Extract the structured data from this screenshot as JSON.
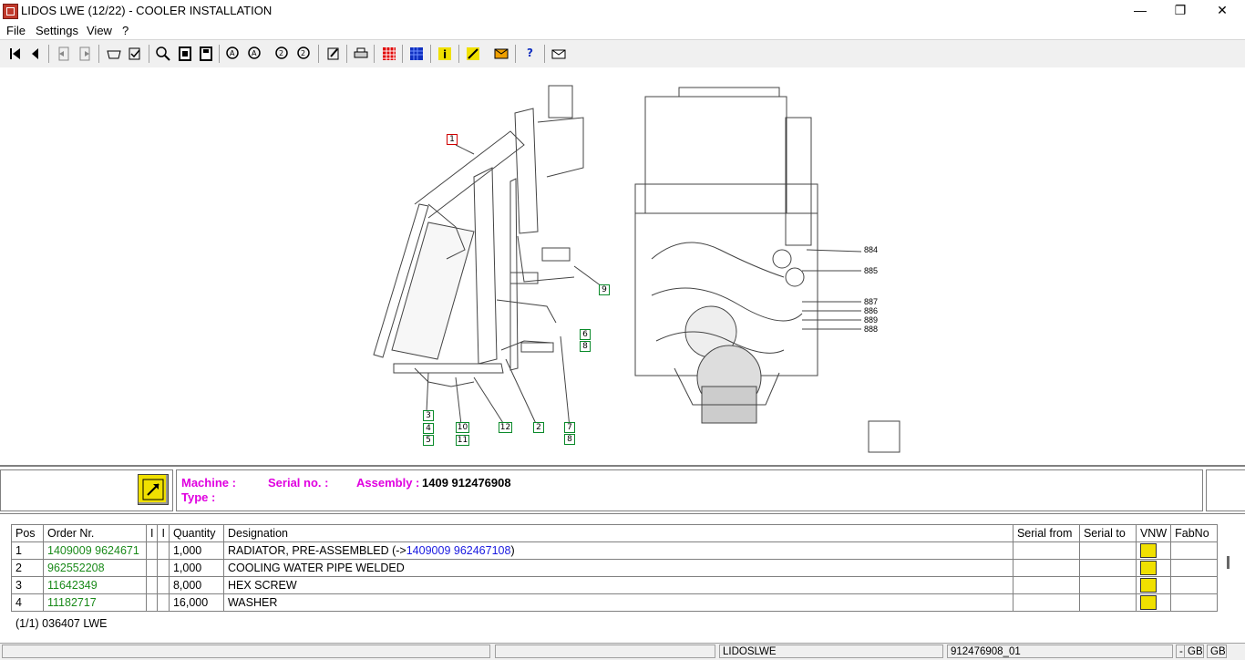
{
  "window": {
    "title": "LIDOS LWE (12/22) - COOLER INSTALLATION",
    "minimize": "—",
    "maximize": "❐",
    "close": "✕"
  },
  "menu": [
    "File",
    "Settings",
    "View",
    "?"
  ],
  "toolbar_icons": [
    "first-icon",
    "prev-icon",
    "back-icon",
    "forward-icon",
    "basket-icon",
    "checklist-icon",
    "zoom-icon",
    "page-icon",
    "page-fit-icon",
    "search-a-icon",
    "search-a2-icon",
    "search-2-icon",
    "search-22-icon",
    "edit-icon",
    "print-icon",
    "grid-icon",
    "filter-icon",
    "info-icon",
    "tools-icon",
    "order-icon",
    "help-icon",
    "mail-icon"
  ],
  "callouts": {
    "c1": "1",
    "c9": "9",
    "c6": "6",
    "c8a": "8",
    "c3": "3",
    "c4": "4",
    "c5": "5",
    "c10": "10",
    "c11": "11",
    "c12": "12",
    "c2": "2",
    "c7": "7",
    "c8b": "8",
    "r884": "884",
    "r885": "885",
    "r887": "887",
    "r886": "886",
    "r889": "889",
    "r888": "888"
  },
  "info": {
    "machine_label": "Machine :",
    "type_label": "Type :",
    "serial_label": "Serial no. :",
    "assembly_label": "Assembly :",
    "assembly_value": "1409 912476908"
  },
  "table": {
    "headers": [
      "Pos",
      "Order Nr.",
      "I",
      "I",
      "Quantity",
      "Designation",
      "Serial from",
      "Serial to",
      "VNW",
      "FabNo"
    ],
    "rows": [
      {
        "pos": "1",
        "order": "1409009 9624671",
        "qty": "1,000",
        "desig": "RADIATOR, PRE-ASSEMBLED (->",
        "link": "1409009 962467108",
        "suffix": ")"
      },
      {
        "pos": "2",
        "order": "962552208",
        "qty": "1,000",
        "desig": "COOLING WATER PIPE WELDED",
        "link": "",
        "suffix": ""
      },
      {
        "pos": "3",
        "order": "11642349",
        "qty": "8,000",
        "desig": "HEX SCREW",
        "link": "",
        "suffix": ""
      },
      {
        "pos": "4",
        "order": "11182717",
        "qty": "16,000",
        "desig": "WASHER",
        "link": "",
        "suffix": ""
      }
    ],
    "footer": "(1/1) 036407 LWE"
  },
  "status": {
    "module": "LIDOSLWE",
    "doc": "912476908_01",
    "dash": "-",
    "lang1": "GB",
    "lang2": "GB"
  }
}
